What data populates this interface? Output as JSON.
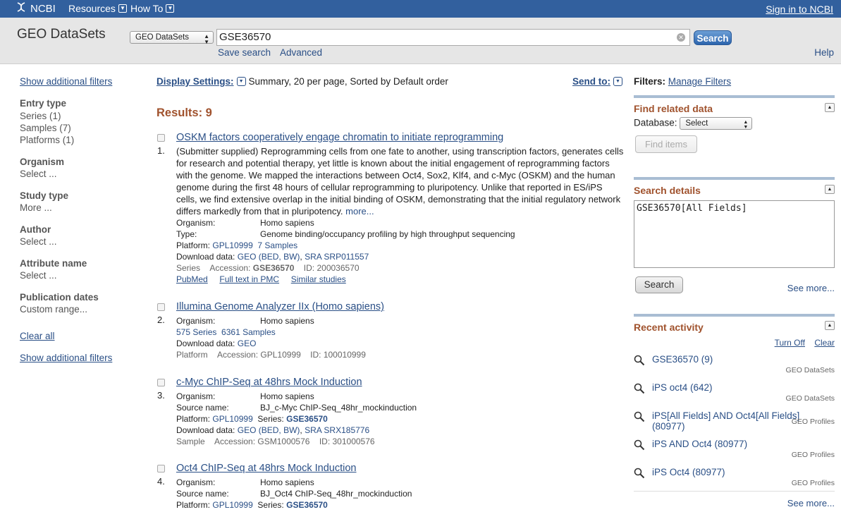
{
  "top_bar": {
    "logo": "NCBI",
    "resources": "Resources",
    "howto": "How To",
    "signin": "Sign in to NCBI"
  },
  "search_bar": {
    "db_title": "GEO DataSets",
    "db_select": "GEO DataSets",
    "term": "GSE36570",
    "search_button": "Search",
    "save_search": "Save search",
    "advanced": "Advanced",
    "help": "Help"
  },
  "left": {
    "show_filters": "Show additional filters",
    "entry_type": {
      "header": "Entry type",
      "items": [
        "Series (1)",
        "Samples (7)",
        "Platforms (1)"
      ]
    },
    "organism": {
      "header": "Organism",
      "item": "Select ..."
    },
    "study_type": {
      "header": "Study type",
      "item": "More ..."
    },
    "author": {
      "header": "Author",
      "item": "Select ..."
    },
    "attribute": {
      "header": "Attribute name",
      "item": "Select ..."
    },
    "pubdates": {
      "header": "Publication dates",
      "item": "Custom range..."
    },
    "clear_all": "Clear all",
    "show_filters_2": "Show additional filters"
  },
  "center": {
    "display_settings": "Display Settings:",
    "display_summary": "Summary, 20 per page, Sorted by Default order",
    "send_to": "Send to:",
    "results": "Results: 9",
    "records": [
      {
        "num": "1.",
        "title": "OSKM factors cooperatively engage chromatin to initiate reprogramming",
        "desc_lines": [
          "(Submitter supplied) Reprogramming cells from one fate to another, using transcription factors, generates cells",
          "for research and potential therapy, yet little is known about the initial engagement of reprogramming factors",
          "with the genome. We mapped the interactions between Oct4, Sox2, Klf4, and c-Myc (OSKM) and the human",
          "genome during the first 48 hours of cellular reprogramming to pluripotency. Unlike that reported in ES/iPS",
          "cells, we find extensive overlap in the initial binding of OSKM, demonstrating that the initial regulatory network",
          "differs markedly from that in pluripotency."
        ],
        "more": "more...",
        "organism_k": "Organism:",
        "organism_v": "Homo sapiens",
        "type_k": "Type:",
        "type_v": "Genome binding/occupancy profiling by high throughput sequencing",
        "platform_k": "Platform:",
        "platform_v": "GPL10999",
        "samples": "7 Samples",
        "download_k": "Download data:",
        "download_geo": "GEO (BED, BW)",
        "download_sra": "SRA SRP011557",
        "entry": "Series",
        "acc_k": "Accession:",
        "acc_v": "GSE36570",
        "id_k": "ID:",
        "id_v": "200036570",
        "links": [
          "PubMed",
          "Full text in PMC",
          "Similar studies"
        ]
      },
      {
        "num": "2.",
        "title": "Illumina Genome Analyzer IIx (Homo sapiens)",
        "organism_k": "Organism:",
        "organism_v": "Homo sapiens",
        "series": "575 Series",
        "samples": "6361 Samples",
        "download_k": "Download data:",
        "download_geo": "GEO",
        "entry": "Platform",
        "acc_k": "Accession:",
        "acc_v": "GPL10999",
        "id_k": "ID:",
        "id_v": "100010999"
      },
      {
        "num": "3.",
        "title": "c-Myc ChIP-Seq at 48hrs Mock Induction",
        "organism_k": "Organism:",
        "organism_v": "Homo sapiens",
        "source_k": "Source name:",
        "source_v": "BJ_c-Myc ChIP-Seq_48hr_mockinduction",
        "platform_k": "Platform:",
        "platform_v": "GPL10999",
        "series_k": "Series:",
        "series_v": "GSE36570",
        "download_k": "Download data:",
        "download_geo": "GEO (BED, BW)",
        "download_sra": "SRA SRX185776",
        "entry": "Sample",
        "acc_k": "Accession:",
        "acc_v": "GSM1000576",
        "id_k": "ID:",
        "id_v": "301000576"
      },
      {
        "num": "4.",
        "title": "Oct4 ChIP-Seq at 48hrs Mock Induction",
        "organism_k": "Organism:",
        "organism_v": "Homo sapiens",
        "source_k": "Source name:",
        "source_v": "BJ_Oct4 ChIP-Seq_48hr_mockinduction",
        "platform_k": "Platform:",
        "platform_v": "GPL10999",
        "series_k": "Series:",
        "series_v": "GSE36570"
      }
    ]
  },
  "right": {
    "filters_label": "Filters:",
    "manage_filters": "Manage Filters",
    "find_related": "Find related data",
    "database_label": "Database:",
    "database_select": "Select",
    "find_items": "Find items",
    "search_details": "Search details",
    "details_text": "GSE36570[All Fields]",
    "search_button": "Search",
    "see_more": "See more...",
    "recent_activity": "Recent activity",
    "turn_off": "Turn Off",
    "clear": "Clear",
    "activity": [
      {
        "q": "GSE36570 (9)",
        "src": "GEO DataSets"
      },
      {
        "q": "iPS oct4 (642)",
        "src": "GEO DataSets"
      },
      {
        "q": "iPS[All Fields] AND Oct4[All Fields] (80977)",
        "src": "GEO Profiles"
      },
      {
        "q": "iPS AND Oct4 (80977)",
        "src": "GEO Profiles"
      },
      {
        "q": "iPS Oct4 (80977)",
        "src": "GEO Profiles"
      }
    ],
    "see_more_2": "See more..."
  },
  "icons": {
    "logo": "ncbi-helix-icon",
    "search": "magnifier-icon",
    "collapse": "triangle-up-icon",
    "dropdown": "chevron-down-icon"
  },
  "colors": {
    "topbar": "#32609e",
    "link": "#2a4f86",
    "heading": "#a0522d"
  }
}
